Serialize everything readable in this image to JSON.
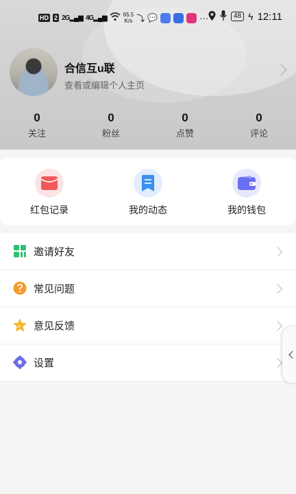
{
  "status_bar": {
    "hd_label": "HD",
    "sim1": "2",
    "sig1": "2G",
    "sig2": "4G",
    "net_speed_value": "65.5",
    "net_speed_unit": "K/s",
    "battery": "48",
    "time": "12:11"
  },
  "profile": {
    "username": "合信互u联",
    "subtitle": "查看或编辑个人主页"
  },
  "stats": [
    {
      "value": "0",
      "label": "关注"
    },
    {
      "value": "0",
      "label": "粉丝"
    },
    {
      "value": "0",
      "label": "点赞"
    },
    {
      "value": "0",
      "label": "评论"
    }
  ],
  "quick_actions": [
    {
      "label": "红包记录",
      "icon": "red-envelope-icon",
      "color": "#f05a5a"
    },
    {
      "label": "我的动态",
      "icon": "note-icon",
      "color": "#3b8ff0"
    },
    {
      "label": "我的钱包",
      "icon": "wallet-icon",
      "color": "#6a6ef2"
    }
  ],
  "menu": [
    {
      "label": "邀请好友",
      "icon": "invite-grid-icon",
      "color": "#2fbf71"
    },
    {
      "label": "常见问题",
      "icon": "question-icon",
      "color": "#f39a2b"
    },
    {
      "label": "意见反馈",
      "icon": "star-feedback-icon",
      "color": "#f2b72b"
    },
    {
      "label": "设置",
      "icon": "gear-icon",
      "color": "#6b6fe8"
    }
  ],
  "colors": {
    "header_bg": "#d2d2d2",
    "page_bg": "#f5f5f5"
  }
}
